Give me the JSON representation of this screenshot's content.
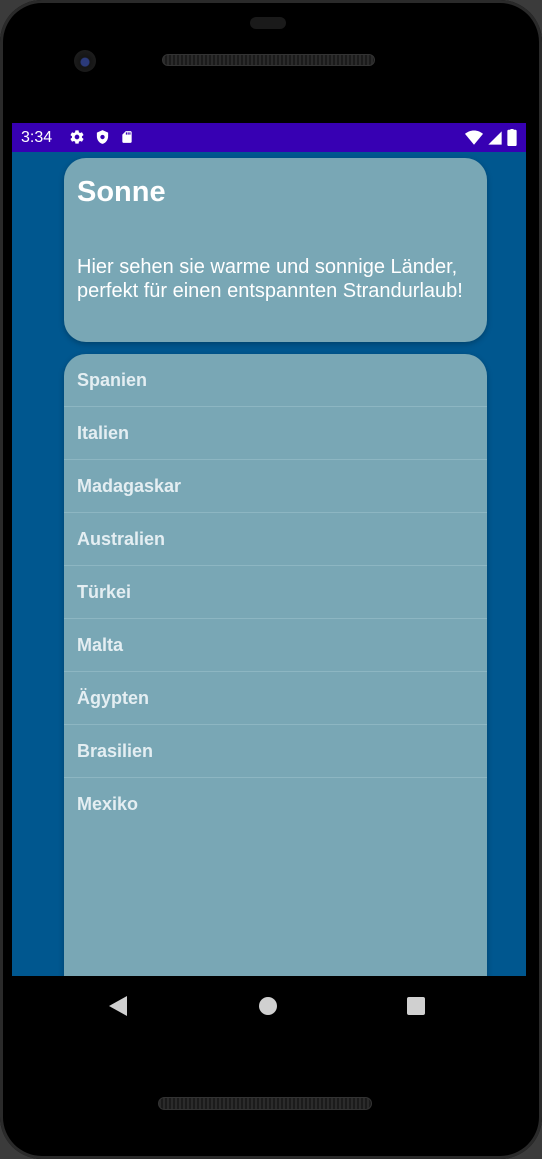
{
  "status_bar": {
    "time": "3:34",
    "background": "#3700b3",
    "left_icons": [
      "settings-gear-icon",
      "shield-icon",
      "sd-card-icon"
    ],
    "right_icons": [
      "wifi-icon",
      "cell-signal-icon",
      "battery-icon"
    ]
  },
  "header": {
    "title": "Sonne",
    "description": "Hier sehen sie warme und sonnige Länder, perfekt für einen entspannten Strandurlaub!"
  },
  "countries": [
    "Spanien",
    "Italien",
    "Madagaskar",
    "Australien",
    "Türkei",
    "Malta",
    "Ägypten",
    "Brasilien",
    "Mexiko"
  ],
  "colors": {
    "screen_background": "#00578f",
    "card_background": "#79a7b5",
    "list_text": "#e4eef2"
  },
  "nav_bar": {
    "icons": [
      "back-icon",
      "home-icon",
      "recents-icon"
    ]
  }
}
